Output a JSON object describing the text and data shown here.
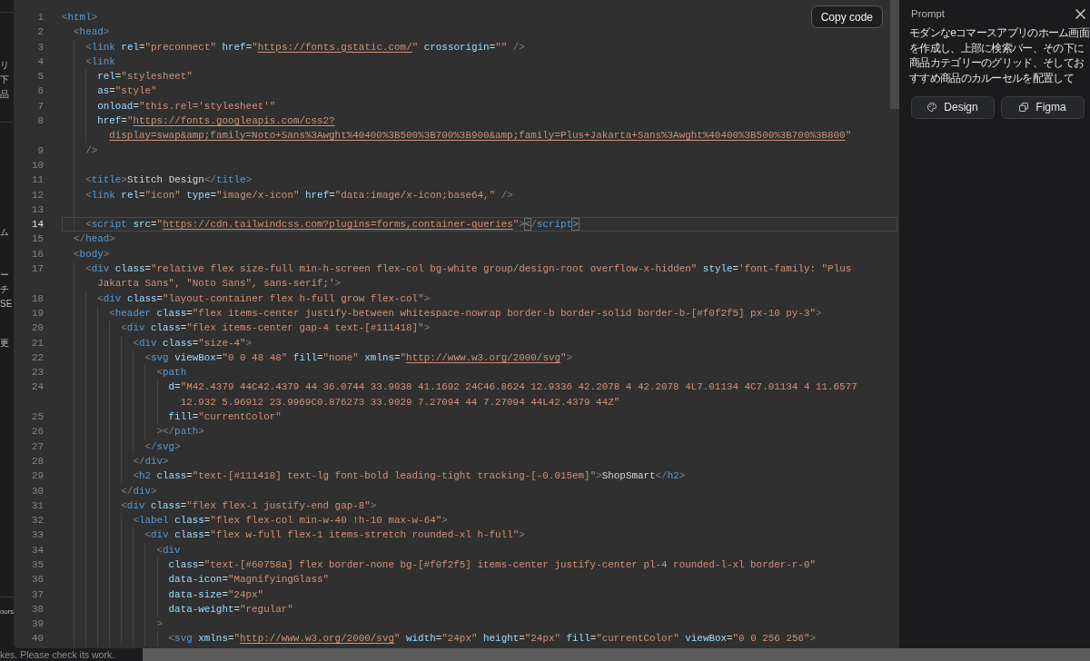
{
  "background_page": {
    "paragraphs": [
      {
        "lines": [
          "リ",
          "下",
          "品"
        ]
      },
      {
        "lines": [
          "ム"
        ]
      },
      {
        "lines": [
          "ー",
          "チ",
          "SE"
        ]
      },
      {
        "lines": [
          "更"
        ]
      },
      {
        "lines": [
          "ours"
        ]
      }
    ],
    "notice": "kes. Please check its work."
  },
  "code_viewer": {
    "copy_button": "Copy code",
    "lines": [
      {
        "number": "1",
        "current": false,
        "parts": [
          {
            "tokens": [
              {
                "kind": "punct",
                "text": "<"
              },
              {
                "kind": "tag",
                "text": "html"
              },
              {
                "kind": "punct",
                "text": ">"
              }
            ]
          }
        ]
      },
      {
        "number": "2",
        "current": false,
        "parts": [
          {
            "tokens": [
              {
                "kind": "punct",
                "text": "  <"
              },
              {
                "kind": "tag",
                "text": "head"
              },
              {
                "kind": "punct",
                "text": ">"
              }
            ]
          }
        ]
      },
      {
        "number": "3",
        "current": false,
        "parts": [
          {
            "tokens": [
              {
                "kind": "punct",
                "text": "    <"
              },
              {
                "kind": "tag",
                "text": "link"
              },
              {
                "kind": "attr",
                "text": " rel"
              },
              {
                "kind": "plain",
                "text": "="
              },
              {
                "kind": "string",
                "text": "\"preconnect\""
              },
              {
                "kind": "attr",
                "text": " href"
              },
              {
                "kind": "plain",
                "text": "="
              },
              {
                "kind": "string",
                "text": "\""
              },
              {
                "kind": "url",
                "text": "https://fonts.gstatic.com/"
              },
              {
                "kind": "string",
                "text": "\""
              },
              {
                "kind": "attr",
                "text": " crossorigin"
              },
              {
                "kind": "plain",
                "text": "="
              },
              {
                "kind": "string",
                "text": "\"\""
              },
              {
                "kind": "punct",
                "text": " />"
              }
            ]
          }
        ]
      },
      {
        "number": "4",
        "current": false,
        "parts": [
          {
            "tokens": [
              {
                "kind": "punct",
                "text": "    <"
              },
              {
                "kind": "tag",
                "text": "link"
              }
            ]
          }
        ]
      },
      {
        "number": "5",
        "current": false,
        "parts": [
          {
            "tokens": [
              {
                "kind": "attr",
                "text": "      rel"
              },
              {
                "kind": "plain",
                "text": "="
              },
              {
                "kind": "string",
                "text": "\"stylesheet\""
              }
            ]
          }
        ]
      },
      {
        "number": "6",
        "current": false,
        "parts": [
          {
            "tokens": [
              {
                "kind": "attr",
                "text": "      as"
              },
              {
                "kind": "plain",
                "text": "="
              },
              {
                "kind": "string",
                "text": "\"style\""
              }
            ]
          }
        ]
      },
      {
        "number": "7",
        "current": false,
        "parts": [
          {
            "tokens": [
              {
                "kind": "attr",
                "text": "      onload"
              },
              {
                "kind": "plain",
                "text": "="
              },
              {
                "kind": "string",
                "text": "\"this.rel='stylesheet'\""
              }
            ]
          }
        ]
      },
      {
        "number": "8",
        "current": false,
        "parts": [
          {
            "tokens": [
              {
                "kind": "attr",
                "text": "      href"
              },
              {
                "kind": "plain",
                "text": "="
              },
              {
                "kind": "string",
                "text": "\""
              },
              {
                "kind": "url",
                "text": "https://fonts.googleapis.com/css2?"
              }
            ]
          },
          {
            "tokens": [
              {
                "kind": "url",
                "text": "        display=swap&amp;family=Noto+Sans%3Awght%40400%3B500%3B700%3B900&amp;family=Plus+Jakarta+Sans%3Awght%40400%3B500%3B700%3B800"
              },
              {
                "kind": "string",
                "text": "\""
              }
            ]
          }
        ]
      },
      {
        "number": "9",
        "current": false,
        "parts": [
          {
            "tokens": [
              {
                "kind": "punct",
                "text": "    />"
              }
            ]
          }
        ]
      },
      {
        "number": "10",
        "current": false
      },
      {
        "number": "11",
        "current": false,
        "parts": [
          {
            "tokens": [
              {
                "kind": "punct",
                "text": "    <"
              },
              {
                "kind": "tag",
                "text": "title"
              },
              {
                "kind": "punct",
                "text": ">"
              },
              {
                "kind": "plain",
                "text": "Stitch Design"
              },
              {
                "kind": "punct",
                "text": "</"
              },
              {
                "kind": "tag",
                "text": "title"
              },
              {
                "kind": "punct",
                "text": ">"
              }
            ]
          }
        ]
      },
      {
        "number": "12",
        "current": false,
        "parts": [
          {
            "tokens": [
              {
                "kind": "punct",
                "text": "    <"
              },
              {
                "kind": "tag",
                "text": "link"
              },
              {
                "kind": "attr",
                "text": " rel"
              },
              {
                "kind": "plain",
                "text": "="
              },
              {
                "kind": "string",
                "text": "\"icon\""
              },
              {
                "kind": "attr",
                "text": " type"
              },
              {
                "kind": "plain",
                "text": "="
              },
              {
                "kind": "string",
                "text": "\"image/x-icon\""
              },
              {
                "kind": "attr",
                "text": " href"
              },
              {
                "kind": "plain",
                "text": "="
              },
              {
                "kind": "string",
                "text": "\"data:image/x-icon;base64,\""
              },
              {
                "kind": "punct",
                "text": " />"
              }
            ]
          }
        ]
      },
      {
        "number": "13",
        "current": false
      },
      {
        "number": "14",
        "current": true,
        "parts": [
          {
            "tokens": [
              {
                "kind": "punct",
                "text": "    <"
              },
              {
                "kind": "tag",
                "text": "script"
              },
              {
                "kind": "attr",
                "text": " src"
              },
              {
                "kind": "plain",
                "text": "="
              },
              {
                "kind": "string",
                "text": "\""
              },
              {
                "kind": "url",
                "text": "https://cdn.tailwindcss.com?plugins=forms,container-queries"
              },
              {
                "kind": "string",
                "text": "\""
              },
              {
                "kind": "punct",
                "text": ">"
              },
              {
                "kind": "match",
                "text": "<"
              },
              {
                "kind": "punct",
                "text": "/"
              },
              {
                "kind": "tag",
                "text": "script"
              },
              {
                "kind": "match",
                "text": ">"
              }
            ]
          }
        ]
      },
      {
        "number": "15",
        "current": false,
        "parts": [
          {
            "tokens": [
              {
                "kind": "punct",
                "text": "  </"
              },
              {
                "kind": "tag",
                "text": "head"
              },
              {
                "kind": "punct",
                "text": ">"
              }
            ]
          }
        ]
      },
      {
        "number": "16",
        "current": false,
        "parts": [
          {
            "tokens": [
              {
                "kind": "punct",
                "text": "  <"
              },
              {
                "kind": "tag",
                "text": "body"
              },
              {
                "kind": "punct",
                "text": ">"
              }
            ]
          }
        ]
      },
      {
        "number": "17",
        "current": false,
        "parts": [
          {
            "tokens": [
              {
                "kind": "punct",
                "text": "    <"
              },
              {
                "kind": "tag",
                "text": "div"
              },
              {
                "kind": "attr",
                "text": " class"
              },
              {
                "kind": "plain",
                "text": "="
              },
              {
                "kind": "string",
                "text": "\"relative flex size-full min-h-screen flex-col bg-white group/design-root overflow-x-hidden\""
              },
              {
                "kind": "attr",
                "text": " style"
              },
              {
                "kind": "plain",
                "text": "="
              },
              {
                "kind": "string",
                "text": "'font-family: \"Plus"
              }
            ]
          },
          {
            "tokens": [
              {
                "kind": "string",
                "text": "      Jakarta Sans\", \"Noto Sans\", sans-serif;'"
              },
              {
                "kind": "punct",
                "text": ">"
              }
            ]
          }
        ]
      },
      {
        "number": "18",
        "current": false,
        "parts": [
          {
            "tokens": [
              {
                "kind": "punct",
                "text": "      <"
              },
              {
                "kind": "tag",
                "text": "div"
              },
              {
                "kind": "attr",
                "text": " class"
              },
              {
                "kind": "plain",
                "text": "="
              },
              {
                "kind": "string",
                "text": "\"layout-container flex h-full grow flex-col\""
              },
              {
                "kind": "punct",
                "text": ">"
              }
            ]
          }
        ]
      },
      {
        "number": "19",
        "current": false,
        "parts": [
          {
            "tokens": [
              {
                "kind": "punct",
                "text": "        <"
              },
              {
                "kind": "tag",
                "text": "header"
              },
              {
                "kind": "attr",
                "text": " class"
              },
              {
                "kind": "plain",
                "text": "="
              },
              {
                "kind": "string",
                "text": "\"flex items-center justify-between whitespace-nowrap border-b border-solid border-b-[#f0f2f5] px-10 py-3\""
              },
              {
                "kind": "punct",
                "text": ">"
              }
            ]
          }
        ]
      },
      {
        "number": "20",
        "current": false,
        "parts": [
          {
            "tokens": [
              {
                "kind": "punct",
                "text": "          <"
              },
              {
                "kind": "tag",
                "text": "div"
              },
              {
                "kind": "attr",
                "text": " class"
              },
              {
                "kind": "plain",
                "text": "="
              },
              {
                "kind": "string",
                "text": "\"flex items-center gap-4 text-[#111418]\""
              },
              {
                "kind": "punct",
                "text": ">"
              }
            ]
          }
        ]
      },
      {
        "number": "21",
        "current": false,
        "parts": [
          {
            "tokens": [
              {
                "kind": "punct",
                "text": "            <"
              },
              {
                "kind": "tag",
                "text": "div"
              },
              {
                "kind": "attr",
                "text": " class"
              },
              {
                "kind": "plain",
                "text": "="
              },
              {
                "kind": "string",
                "text": "\"size-4\""
              },
              {
                "kind": "punct",
                "text": ">"
              }
            ]
          }
        ]
      },
      {
        "number": "22",
        "current": false,
        "parts": [
          {
            "tokens": [
              {
                "kind": "punct",
                "text": "              <"
              },
              {
                "kind": "tag",
                "text": "svg"
              },
              {
                "kind": "attr",
                "text": " viewBox"
              },
              {
                "kind": "plain",
                "text": "="
              },
              {
                "kind": "string",
                "text": "\"0 0 48 48\""
              },
              {
                "kind": "attr",
                "text": " fill"
              },
              {
                "kind": "plain",
                "text": "="
              },
              {
                "kind": "string",
                "text": "\"none\""
              },
              {
                "kind": "attr",
                "text": " xmlns"
              },
              {
                "kind": "plain",
                "text": "="
              },
              {
                "kind": "string",
                "text": "\""
              },
              {
                "kind": "url",
                "text": "http://www.w3.org/2000/svg"
              },
              {
                "kind": "string",
                "text": "\""
              },
              {
                "kind": "punct",
                "text": ">"
              }
            ]
          }
        ]
      },
      {
        "number": "23",
        "current": false,
        "parts": [
          {
            "tokens": [
              {
                "kind": "punct",
                "text": "                <"
              },
              {
                "kind": "tag",
                "text": "path"
              }
            ]
          }
        ]
      },
      {
        "number": "24",
        "current": false,
        "parts": [
          {
            "tokens": [
              {
                "kind": "attr",
                "text": "                  d"
              },
              {
                "kind": "plain",
                "text": "="
              },
              {
                "kind": "string",
                "text": "\"M42.4379 44C42.4379 44 36.0744 33.9038 41.1692 24C46.8624 12.9336 42.2078 4 42.2078 4L7.01134 4C7.01134 4 11.6577"
              }
            ]
          },
          {
            "tokens": [
              {
                "kind": "string",
                "text": "                    12.932 5.96912 23.9969C0.876273 33.9029 7.27094 44 7.27094 44L42.4379 44Z\""
              }
            ]
          }
        ]
      },
      {
        "number": "25",
        "current": false,
        "parts": [
          {
            "tokens": [
              {
                "kind": "attr",
                "text": "                  fill"
              },
              {
                "kind": "plain",
                "text": "="
              },
              {
                "kind": "string",
                "text": "\"currentColor\""
              }
            ]
          }
        ]
      },
      {
        "number": "26",
        "current": false,
        "parts": [
          {
            "tokens": [
              {
                "kind": "punct",
                "text": "                ></"
              },
              {
                "kind": "tag",
                "text": "path"
              },
              {
                "kind": "punct",
                "text": ">"
              }
            ]
          }
        ]
      },
      {
        "number": "27",
        "current": false,
        "parts": [
          {
            "tokens": [
              {
                "kind": "punct",
                "text": "              </"
              },
              {
                "kind": "tag",
                "text": "svg"
              },
              {
                "kind": "punct",
                "text": ">"
              }
            ]
          }
        ]
      },
      {
        "number": "28",
        "current": false,
        "parts": [
          {
            "tokens": [
              {
                "kind": "punct",
                "text": "            </"
              },
              {
                "kind": "tag",
                "text": "div"
              },
              {
                "kind": "punct",
                "text": ">"
              }
            ]
          }
        ]
      },
      {
        "number": "29",
        "current": false,
        "parts": [
          {
            "tokens": [
              {
                "kind": "punct",
                "text": "            <"
              },
              {
                "kind": "tag",
                "text": "h2"
              },
              {
                "kind": "attr",
                "text": " class"
              },
              {
                "kind": "plain",
                "text": "="
              },
              {
                "kind": "string",
                "text": "\"text-[#111418] text-lg font-bold leading-tight tracking-[-0.015em]\""
              },
              {
                "kind": "punct",
                "text": ">"
              },
              {
                "kind": "plain",
                "text": "ShopSmart"
              },
              {
                "kind": "punct",
                "text": "</"
              },
              {
                "kind": "tag",
                "text": "h2"
              },
              {
                "kind": "punct",
                "text": ">"
              }
            ]
          }
        ]
      },
      {
        "number": "30",
        "current": false,
        "parts": [
          {
            "tokens": [
              {
                "kind": "punct",
                "text": "          </"
              },
              {
                "kind": "tag",
                "text": "div"
              },
              {
                "kind": "punct",
                "text": ">"
              }
            ]
          }
        ]
      },
      {
        "number": "31",
        "current": false,
        "parts": [
          {
            "tokens": [
              {
                "kind": "punct",
                "text": "          <"
              },
              {
                "kind": "tag",
                "text": "div"
              },
              {
                "kind": "attr",
                "text": " class"
              },
              {
                "kind": "plain",
                "text": "="
              },
              {
                "kind": "string",
                "text": "\"flex flex-1 justify-end gap-8\""
              },
              {
                "kind": "punct",
                "text": ">"
              }
            ]
          }
        ]
      },
      {
        "number": "32",
        "current": false,
        "parts": [
          {
            "tokens": [
              {
                "kind": "punct",
                "text": "            <"
              },
              {
                "kind": "tag",
                "text": "label"
              },
              {
                "kind": "attr",
                "text": " class"
              },
              {
                "kind": "plain",
                "text": "="
              },
              {
                "kind": "string",
                "text": "\"flex flex-col min-w-40 !h-10 max-w-64\""
              },
              {
                "kind": "punct",
                "text": ">"
              }
            ]
          }
        ]
      },
      {
        "number": "33",
        "current": false,
        "parts": [
          {
            "tokens": [
              {
                "kind": "punct",
                "text": "              <"
              },
              {
                "kind": "tag",
                "text": "div"
              },
              {
                "kind": "attr",
                "text": " class"
              },
              {
                "kind": "plain",
                "text": "="
              },
              {
                "kind": "string",
                "text": "\"flex w-full flex-1 items-stretch rounded-xl h-full\""
              },
              {
                "kind": "punct",
                "text": ">"
              }
            ]
          }
        ]
      },
      {
        "number": "34",
        "current": false,
        "parts": [
          {
            "tokens": [
              {
                "kind": "punct",
                "text": "                <"
              },
              {
                "kind": "tag",
                "text": "div"
              }
            ]
          }
        ]
      },
      {
        "number": "35",
        "current": false,
        "parts": [
          {
            "tokens": [
              {
                "kind": "attr",
                "text": "                  class"
              },
              {
                "kind": "plain",
                "text": "="
              },
              {
                "kind": "string",
                "text": "\"text-[#60758a] flex border-none bg-[#f0f2f5] items-center justify-center pl-4 rounded-l-xl border-r-0\""
              }
            ]
          }
        ]
      },
      {
        "number": "36",
        "current": false,
        "parts": [
          {
            "tokens": [
              {
                "kind": "attr",
                "text": "                  data-icon"
              },
              {
                "kind": "plain",
                "text": "="
              },
              {
                "kind": "string",
                "text": "\"MagnifyingGlass\""
              }
            ]
          }
        ]
      },
      {
        "number": "37",
        "current": false,
        "parts": [
          {
            "tokens": [
              {
                "kind": "attr",
                "text": "                  data-size"
              },
              {
                "kind": "plain",
                "text": "="
              },
              {
                "kind": "string",
                "text": "\"24px\""
              }
            ]
          }
        ]
      },
      {
        "number": "38",
        "current": false,
        "parts": [
          {
            "tokens": [
              {
                "kind": "attr",
                "text": "                  data-weight"
              },
              {
                "kind": "plain",
                "text": "="
              },
              {
                "kind": "string",
                "text": "\"regular\""
              }
            ]
          }
        ]
      },
      {
        "number": "39",
        "current": false,
        "parts": [
          {
            "tokens": [
              {
                "kind": "punct",
                "text": "                >"
              }
            ]
          }
        ]
      },
      {
        "number": "40",
        "current": false,
        "parts": [
          {
            "tokens": [
              {
                "kind": "punct",
                "text": "                  <"
              },
              {
                "kind": "tag",
                "text": "svg"
              },
              {
                "kind": "attr",
                "text": " xmlns"
              },
              {
                "kind": "plain",
                "text": "="
              },
              {
                "kind": "string",
                "text": "\""
              },
              {
                "kind": "url",
                "text": "http://www.w3.org/2000/svg"
              },
              {
                "kind": "string",
                "text": "\""
              },
              {
                "kind": "attr",
                "text": " width"
              },
              {
                "kind": "plain",
                "text": "="
              },
              {
                "kind": "string",
                "text": "\"24px\""
              },
              {
                "kind": "attr",
                "text": " height"
              },
              {
                "kind": "plain",
                "text": "="
              },
              {
                "kind": "string",
                "text": "\"24px\""
              },
              {
                "kind": "attr",
                "text": " fill"
              },
              {
                "kind": "plain",
                "text": "="
              },
              {
                "kind": "string",
                "text": "\"currentColor\""
              },
              {
                "kind": "attr",
                "text": " viewBox"
              },
              {
                "kind": "plain",
                "text": "="
              },
              {
                "kind": "string",
                "text": "\"0 0 256 256\""
              },
              {
                "kind": "punct",
                "text": ">"
              }
            ]
          }
        ]
      }
    ]
  },
  "prompt_panel": {
    "title": "Prompt",
    "text": "モダンなeコマースアプリのホーム画面を作成し、上部に検索バー、その下に商品カテゴリーのグリッド、そしておすすめ商品のカルーセルを配置して",
    "buttons": [
      "Design",
      "Figma"
    ]
  }
}
